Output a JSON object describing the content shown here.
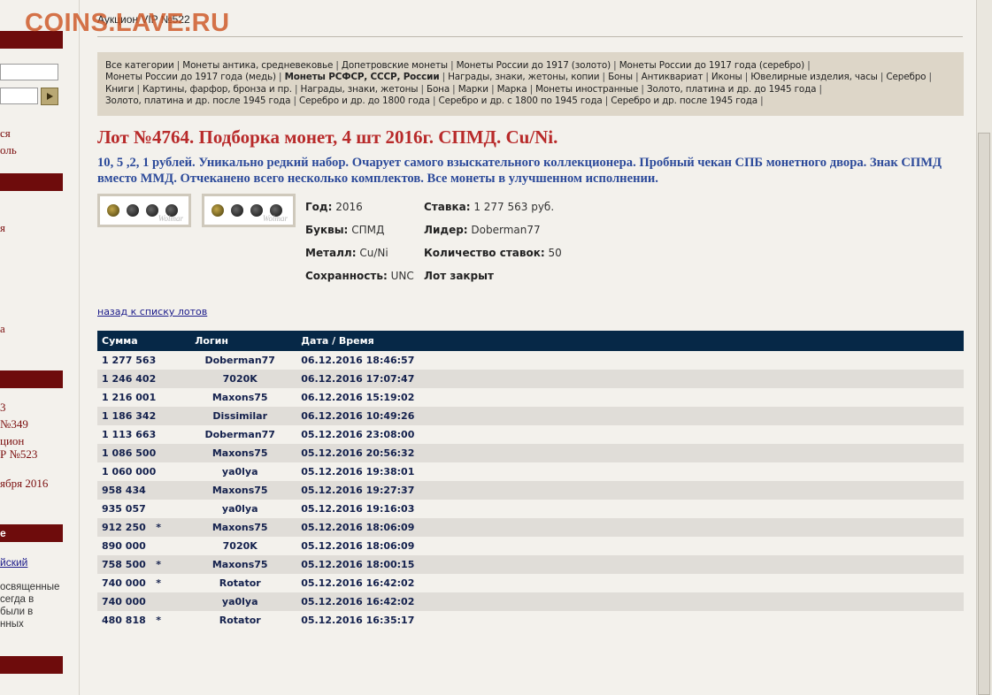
{
  "watermark": "COINS.LAVE.RU",
  "page_heading": "Аукцион VIP №522",
  "categories": [
    {
      "label": "Все категории",
      "bold": false
    },
    {
      "label": "Монеты антика, средневековье",
      "bold": false
    },
    {
      "label": "Допетровские монеты",
      "bold": false
    },
    {
      "label": "Монеты России до 1917 (золото)",
      "bold": false
    },
    {
      "label": "Монеты России до 1917 года (серебро)",
      "bold": false
    },
    {
      "label": "Монеты России до 1917 года (медь)",
      "bold": false
    },
    {
      "label": "Монеты РСФСР, СССР, России",
      "bold": true
    },
    {
      "label": "Награды, знаки, жетоны, копии",
      "bold": false
    },
    {
      "label": "Боны",
      "bold": false
    },
    {
      "label": "Антиквариат",
      "bold": false
    },
    {
      "label": "Иконы",
      "bold": false
    },
    {
      "label": "Ювелирные изделия, часы",
      "bold": false
    },
    {
      "label": "Серебро",
      "bold": false
    },
    {
      "label": "Книги",
      "bold": false
    },
    {
      "label": "Картины, фарфор, бронза и пр.",
      "bold": false
    },
    {
      "label": "Награды, знаки, жетоны",
      "bold": false
    },
    {
      "label": "Бона",
      "bold": false
    },
    {
      "label": "Марки",
      "bold": false
    },
    {
      "label": "Марка",
      "bold": false
    },
    {
      "label": "Монеты иностранные",
      "bold": false
    },
    {
      "label": "Золото, платина и др. до 1945 года",
      "bold": false
    },
    {
      "label": "Золото, платина и др. после 1945 года",
      "bold": false
    },
    {
      "label": "Серебро и др. до 1800 года",
      "bold": false
    },
    {
      "label": "Серебро и др. с 1800 по 1945 года",
      "bold": false
    },
    {
      "label": "Серебро и др. после 1945 года",
      "bold": false
    }
  ],
  "lot": {
    "title": "Лот №4764.  Подборка монет, 4 шт 2016г. СПМД. Cu/Ni.",
    "description": "10, 5 ,2, 1 рублей. Уникально редкий набор. Очарует самого взыскательного коллекционера. Пробный чекан СПБ монетного двора. Знак СПМД вместо ММД. Отчеканено всего несколько комплектов. Все монеты в улучшенном исполнении.",
    "thumbnail_watermark": "Wolmar",
    "year_label": "Год:",
    "year_value": "2016",
    "letters_label": "Буквы:",
    "letters_value": "СПМД",
    "metal_label": "Металл:",
    "metal_value": "Cu/Ni",
    "condition_label": "Сохранность:",
    "condition_value": "UNC",
    "bid_label": "Ставка:",
    "bid_value": "1 277 563 руб.",
    "leader_label": "Лидер:",
    "leader_value": "Doberman77",
    "bids_count_label": "Количество ставок:",
    "bids_count_value": "50",
    "status": "Лот закрыт"
  },
  "back_link": "назад к списку лотов",
  "bids_table": {
    "headers": {
      "sum": "Сумма",
      "login": "Логин",
      "datetime": "Дата / Время"
    },
    "rows": [
      {
        "sum": "1 277 563",
        "mark": "",
        "login": "Doberman77",
        "datetime": "06.12.2016 18:46:57"
      },
      {
        "sum": "1 246 402",
        "mark": "",
        "login": "7020K",
        "datetime": "06.12.2016 17:07:47"
      },
      {
        "sum": "1 216 001",
        "mark": "",
        "login": "Maxons75",
        "datetime": "06.12.2016 15:19:02"
      },
      {
        "sum": "1 186 342",
        "mark": "",
        "login": "Dissimilar",
        "datetime": "06.12.2016 10:49:26"
      },
      {
        "sum": "1 113 663",
        "mark": "",
        "login": "Doberman77",
        "datetime": "05.12.2016 23:08:00"
      },
      {
        "sum": "1 086 500",
        "mark": "",
        "login": "Maxons75",
        "datetime": "05.12.2016 20:56:32"
      },
      {
        "sum": "1 060 000",
        "mark": "",
        "login": "ya0lya",
        "datetime": "05.12.2016 19:38:01"
      },
      {
        "sum": "958 434",
        "mark": "",
        "login": "Maxons75",
        "datetime": "05.12.2016 19:27:37"
      },
      {
        "sum": "935 057",
        "mark": "",
        "login": "ya0lya",
        "datetime": "05.12.2016 19:16:03"
      },
      {
        "sum": "912 250",
        "mark": "*",
        "login": "Maxons75",
        "datetime": "05.12.2016 18:06:09"
      },
      {
        "sum": "890 000",
        "mark": "",
        "login": "7020K",
        "datetime": "05.12.2016 18:06:09"
      },
      {
        "sum": "758 500",
        "mark": "*",
        "login": "Maxons75",
        "datetime": "05.12.2016 18:00:15"
      },
      {
        "sum": "740 000",
        "mark": "*",
        "login": "Rotator",
        "datetime": "05.12.2016 16:42:02"
      },
      {
        "sum": "740 000",
        "mark": "",
        "login": "ya0lya",
        "datetime": "05.12.2016 16:42:02"
      },
      {
        "sum": "480 818",
        "mark": "*",
        "login": "Rotator",
        "datetime": "05.12.2016 16:35:17"
      }
    ]
  },
  "sidebar": {
    "link1": "ся",
    "link2": "оль",
    "item1": "я",
    "item2": "а",
    "auc1": "3",
    "auc2": "№349",
    "auc3": "цион",
    "auc4": "Р №523",
    "date": "ября 2016",
    "section": "е",
    "lang_link": "йский",
    "text1": "освященные",
    "text2": "сегда в",
    "text3": " были в",
    "text4": "нных"
  },
  "colors": {
    "accent_red": "#b82a2a",
    "sidebar_red": "#6e0c0c",
    "table_header": "#062847",
    "description_blue": "#2c4a9a",
    "watermark": "#cd5523"
  }
}
